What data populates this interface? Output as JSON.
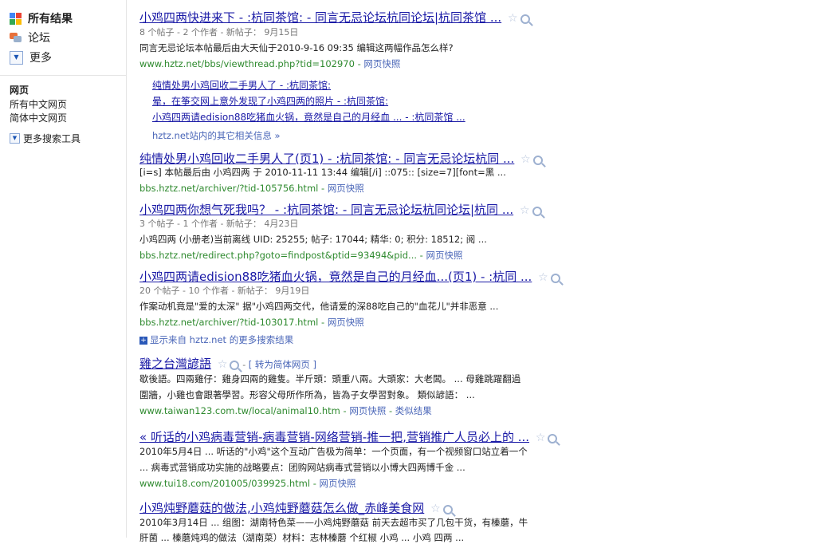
{
  "sidebar": {
    "all_results": "所有结果",
    "forum": "论坛",
    "more": "更多",
    "section_title": "网页",
    "all_chinese": "所有中文网页",
    "simplified": "简体中文网页",
    "more_tools": "更多搜索工具",
    "colors": {
      "g_blue": "#4285f4",
      "g_red": "#ea4335",
      "g_yellow": "#fbbc05",
      "g_green": "#34a853"
    }
  },
  "results": [
    {
      "title": "小鸡四两快进来下 - :杭同茶馆: - 同言无忌论坛杭同论坛|杭同茶馆 ...",
      "meta": "8 个帖子 - 2 个作者 - 新帖子： 9月15日",
      "snippet": "同言无忌论坛本帖最后由大天仙于2010-9-16 09:35 编辑这两幅作品怎么样?",
      "url": "www.hztz.net/bbs/viewthread.php?tid=102970",
      "cache": "网页快照",
      "sub_links": [
        "纯情处男小鸡回收二手男人了 - :杭同茶馆:",
        "晕，在筝交网上意外发现了小鸡四两的照片 - :杭同茶馆:",
        "小鸡四两请edision88吃猪血火锅，竟然是自己的月经血 ... - :杭同茶馆 ..."
      ],
      "site_more": "hztz.net站内的其它相关信息 »"
    },
    {
      "title": "纯情处男小鸡回收二手男人了(页1) - :杭同茶馆: - 同言无忌论坛杭同 ...",
      "snippet": "[i=s] 本帖最后由 小鸡四两 于 2010-11-11 13:44 编辑[/i] ::075:: [size=7][font=黑 ...",
      "url": "bbs.hztz.net/archiver/?tid-105756.html",
      "cache": "网页快照"
    },
    {
      "title": "小鸡四两你想气死我吗？ - :杭同茶馆: - 同言无忌论坛杭同论坛|杭同 ...",
      "meta": "3 个帖子 - 1 个作者 - 新帖子： 4月23日",
      "snippet": "小鸡四两 (小册老)当前离线 UID: 25255; 帖子: 17044; 精华: 0; 积分: 18512; 阅 ...",
      "url": "bbs.hztz.net/redirect.php?goto=findpost&ptid=93494&pid...",
      "cache": "网页快照"
    },
    {
      "title": "小鸡四两请edision88吃猪血火锅，竟然是自己的月经血...(页1) - :杭同 ...",
      "meta": "20 个帖子 - 10 个作者 - 新帖子： 9月19日",
      "snippet": "作案动机竟是\"爱的太深\" 据\"小鸡四两交代，他请爱的深88吃自己的\"血花儿\"并非恶意 ...",
      "url": "bbs.hztz.net/archiver/?tid-103017.html",
      "cache": "网页快照"
    },
    {
      "title": "雞之台灣諺語",
      "translate": "[ 转为简体网页 ]",
      "snippet1": "歇後語。四兩雞仔：雞身四兩的雞隻。半斤頭：頭重八兩。大頭家：大老闆。 ... 母雞跳躍翻過",
      "snippet2": "圍牆，小雞也會跟著學習。形容父母所作所為，皆為子女學習對象。 類似諺語： ...",
      "url": "www.taiwan123.com.tw/local/animal10.htm",
      "cache": "网页快照",
      "similar": "类似结果"
    },
    {
      "title": "« 听话的小鸡病毒营销-病毒营销-网络营销-推一把,营销推广人员必上的 ...",
      "snippet1": "2010年5月4日 ... 听话的\"小鸡\"这个互动广告极为简单：一个页面，有一个视频窗口站立着一个",
      "snippet2": "... 病毒式营销成功实施的战略要点：团购网站病毒式营销以小博大四两博千金 ...",
      "url": "www.tui18.com/201005/039925.html",
      "cache": "网页快照"
    },
    {
      "title": "小鸡炖野蘑菇的做法,小鸡炖野蘑菇怎么做_赤峰美食网",
      "snippet1": "2010年3月14日 ... 组图：湖南特色菜——小鸡炖野蘑菇  前天去超市买了几包干货，有榛蘑，牛",
      "snippet2": "肝菌 ... 榛蘑炖鸡的做法（湖南菜）材料：志林榛蘑 个红椒 小鸡 ... 小鸡 四两 ..."
    }
  ],
  "show_more_from": "显示来自 hztz.net 的更多搜索结果"
}
